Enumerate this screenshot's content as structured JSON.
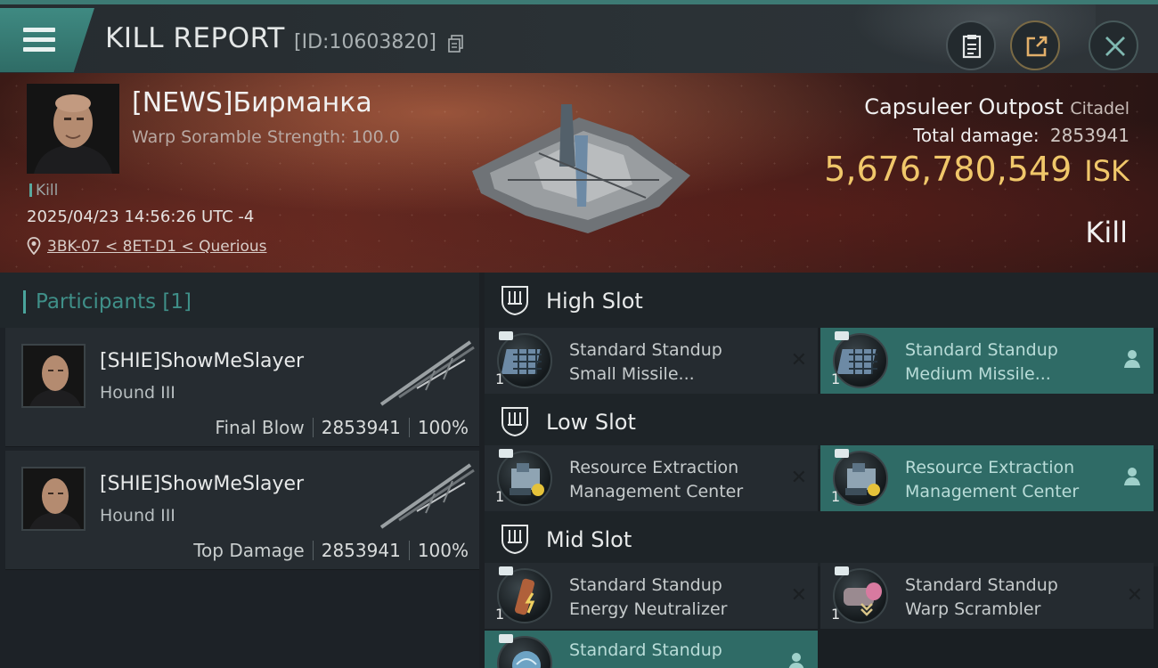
{
  "header": {
    "title": "KILL REPORT",
    "report_id": "[ID:10603820]"
  },
  "victim": {
    "name": "[NEWS]Бирманка",
    "warp_scramble": "Warp Soramble Strength: 100.0",
    "tag": "Kill",
    "timestamp": "2025/04/23 14:56:26 UTC -4",
    "location": "3BK-07 < 8ET-D1 < Querious",
    "ship_name": "Capsuleer Outpost",
    "ship_class": "Citadel",
    "total_damage_label": "Total damage:",
    "total_damage": "2853941",
    "isk_value": "5,676,780,549",
    "isk_unit": "ISK",
    "result": "Kill"
  },
  "participants": {
    "header": "Participants [1]",
    "rows": [
      {
        "name": "[SHIE]ShowMeSlayer",
        "ship": "Hound III",
        "role": "Final Blow",
        "damage": "2853941",
        "percent": "100%"
      },
      {
        "name": "[SHIE]ShowMeSlayer",
        "ship": "Hound III",
        "role": "Top Damage",
        "damage": "2853941",
        "percent": "100%"
      }
    ]
  },
  "slots": {
    "high": {
      "label": "High Slot",
      "modules": [
        {
          "line1": "Standard Standup",
          "line2": "Small Missile...",
          "qty": "1",
          "status": "destroyed"
        },
        {
          "line1": "Standard Standup",
          "line2": "Medium Missile...",
          "qty": "1",
          "status": "dropped"
        }
      ]
    },
    "low": {
      "label": "Low Slot",
      "modules": [
        {
          "line1": "Resource Extraction",
          "line2": "Management Center",
          "qty": "1",
          "status": "destroyed"
        },
        {
          "line1": "Resource Extraction",
          "line2": "Management Center",
          "qty": "1",
          "status": "dropped"
        }
      ]
    },
    "mid": {
      "label": "Mid Slot",
      "modules": [
        {
          "line1": "Standard Standup",
          "line2": "Energy Neutralizer",
          "qty": "1",
          "status": "destroyed"
        },
        {
          "line1": "Standard Standup",
          "line2": "Warp Scrambler",
          "qty": "1",
          "status": "destroyed"
        },
        {
          "line1": "Standard Standup",
          "line2": "",
          "qty": "",
          "status": "dropped"
        }
      ]
    }
  },
  "colors": {
    "accent": "#3f8a82",
    "isk_gold": "#f0c76a",
    "dropped_bg": "#2f6b66"
  }
}
